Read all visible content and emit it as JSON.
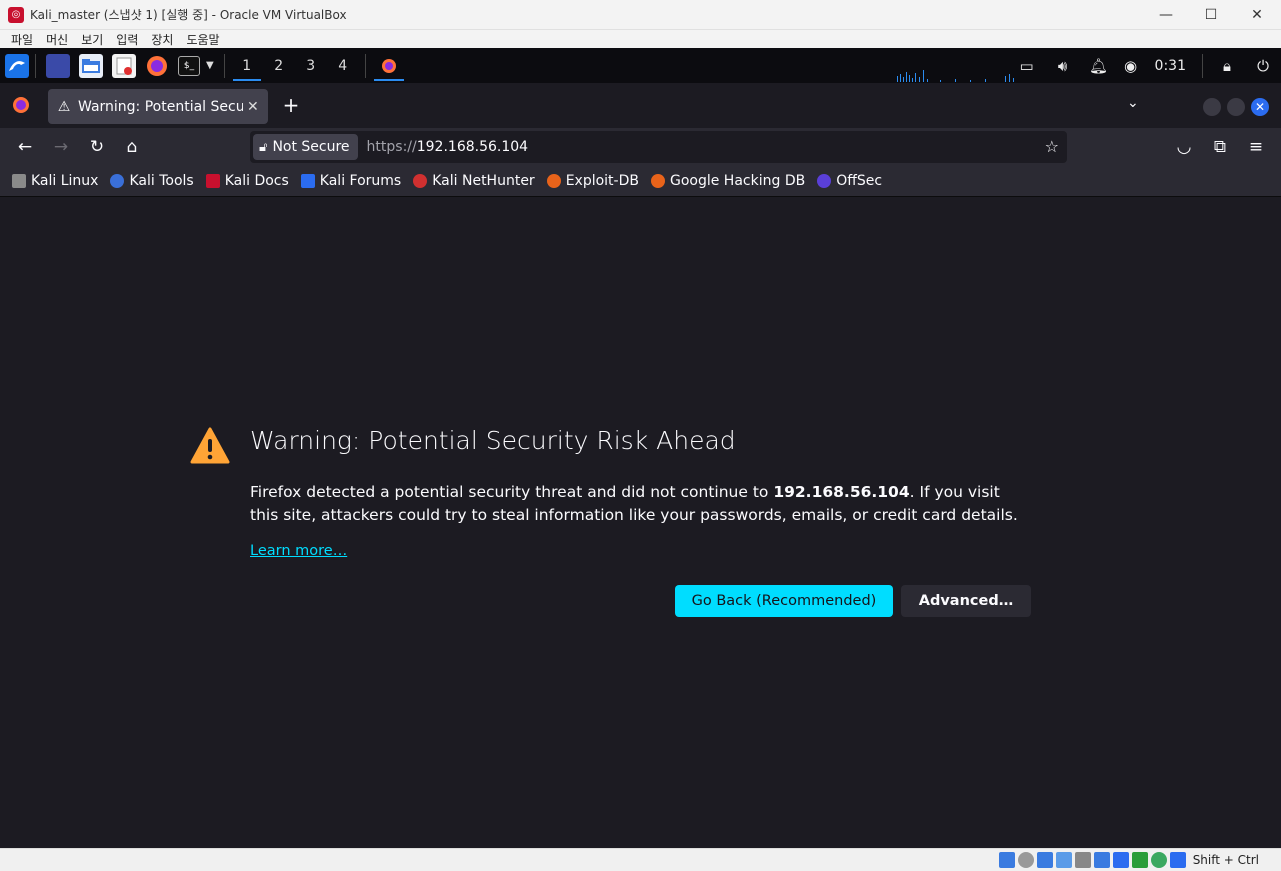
{
  "vbox": {
    "title": "Kali_master (스냅샷 1) [실행 중] - Oracle VM VirtualBox",
    "menu": [
      "파일",
      "머신",
      "보기",
      "입력",
      "장치",
      "도움말"
    ],
    "host_key": "Shift + Ctrl"
  },
  "taskbar": {
    "workspaces": [
      "1",
      "2",
      "3",
      "4"
    ],
    "active_workspace": "1",
    "clock": "0:31"
  },
  "tab": {
    "title": "Warning: Potential Security Risk Ahead"
  },
  "urlbar": {
    "security_label": "Not Secure",
    "scheme": "https://",
    "host": "192.168.56.104"
  },
  "bookmarks": [
    {
      "label": "Kali Linux",
      "color": "#8a8a8a"
    },
    {
      "label": "Kali Tools",
      "color": "#3a6fd8"
    },
    {
      "label": "Kali Docs",
      "color": "#c8102e"
    },
    {
      "label": "Kali Forums",
      "color": "#2b6cf0"
    },
    {
      "label": "Kali NetHunter",
      "color": "#d03030"
    },
    {
      "label": "Exploit-DB",
      "color": "#e8631a"
    },
    {
      "label": "Google Hacking DB",
      "color": "#e8631a"
    },
    {
      "label": "OffSec",
      "color": "#5a3fd8"
    }
  ],
  "page": {
    "heading": "Warning: Potential Security Risk Ahead",
    "desc_before": "Firefox detected a potential security threat and did not continue to ",
    "desc_host": "192.168.56.104",
    "desc_after": ". If you visit this site, attackers could try to steal information like your passwords, emails, or credit card details.",
    "learn_more": "Learn more…",
    "go_back": "Go Back (Recommended)",
    "advanced": "Advanced…"
  },
  "colors": {
    "accent": "#00ddff",
    "warning": "#ffa436",
    "page_bg": "#1c1b22"
  }
}
